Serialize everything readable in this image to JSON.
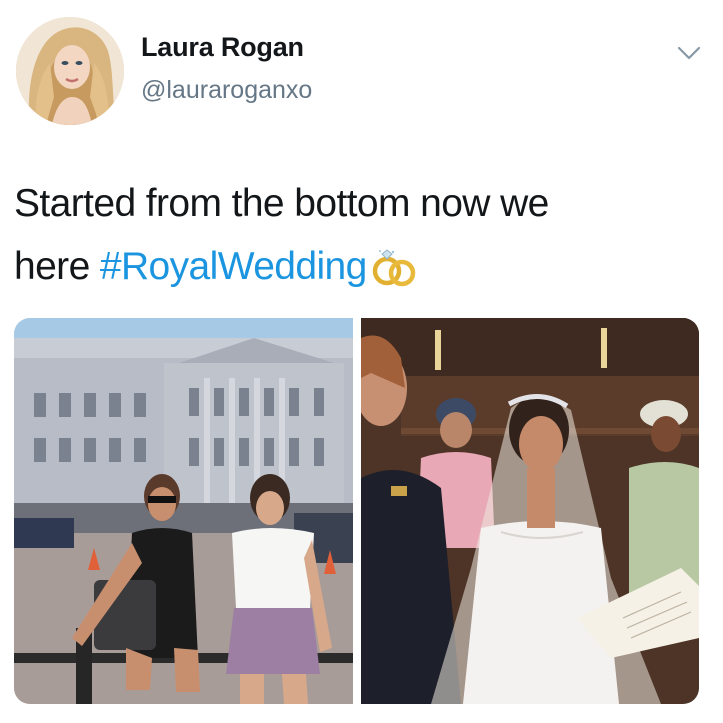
{
  "tweet": {
    "author_name": "Laura Rogan",
    "author_handle": "@lauraroganxo",
    "text_line1": "Started from the bottom now we",
    "text_line2_prefix": "here ",
    "hashtag": "#RoyalWedding",
    "emoji_icon": "wedding-rings-icon",
    "menu_icon": "chevron-down-icon",
    "link_color": "#1b95e0",
    "secondary_text_color": "#657786"
  },
  "media": {
    "photo_count": 2
  }
}
